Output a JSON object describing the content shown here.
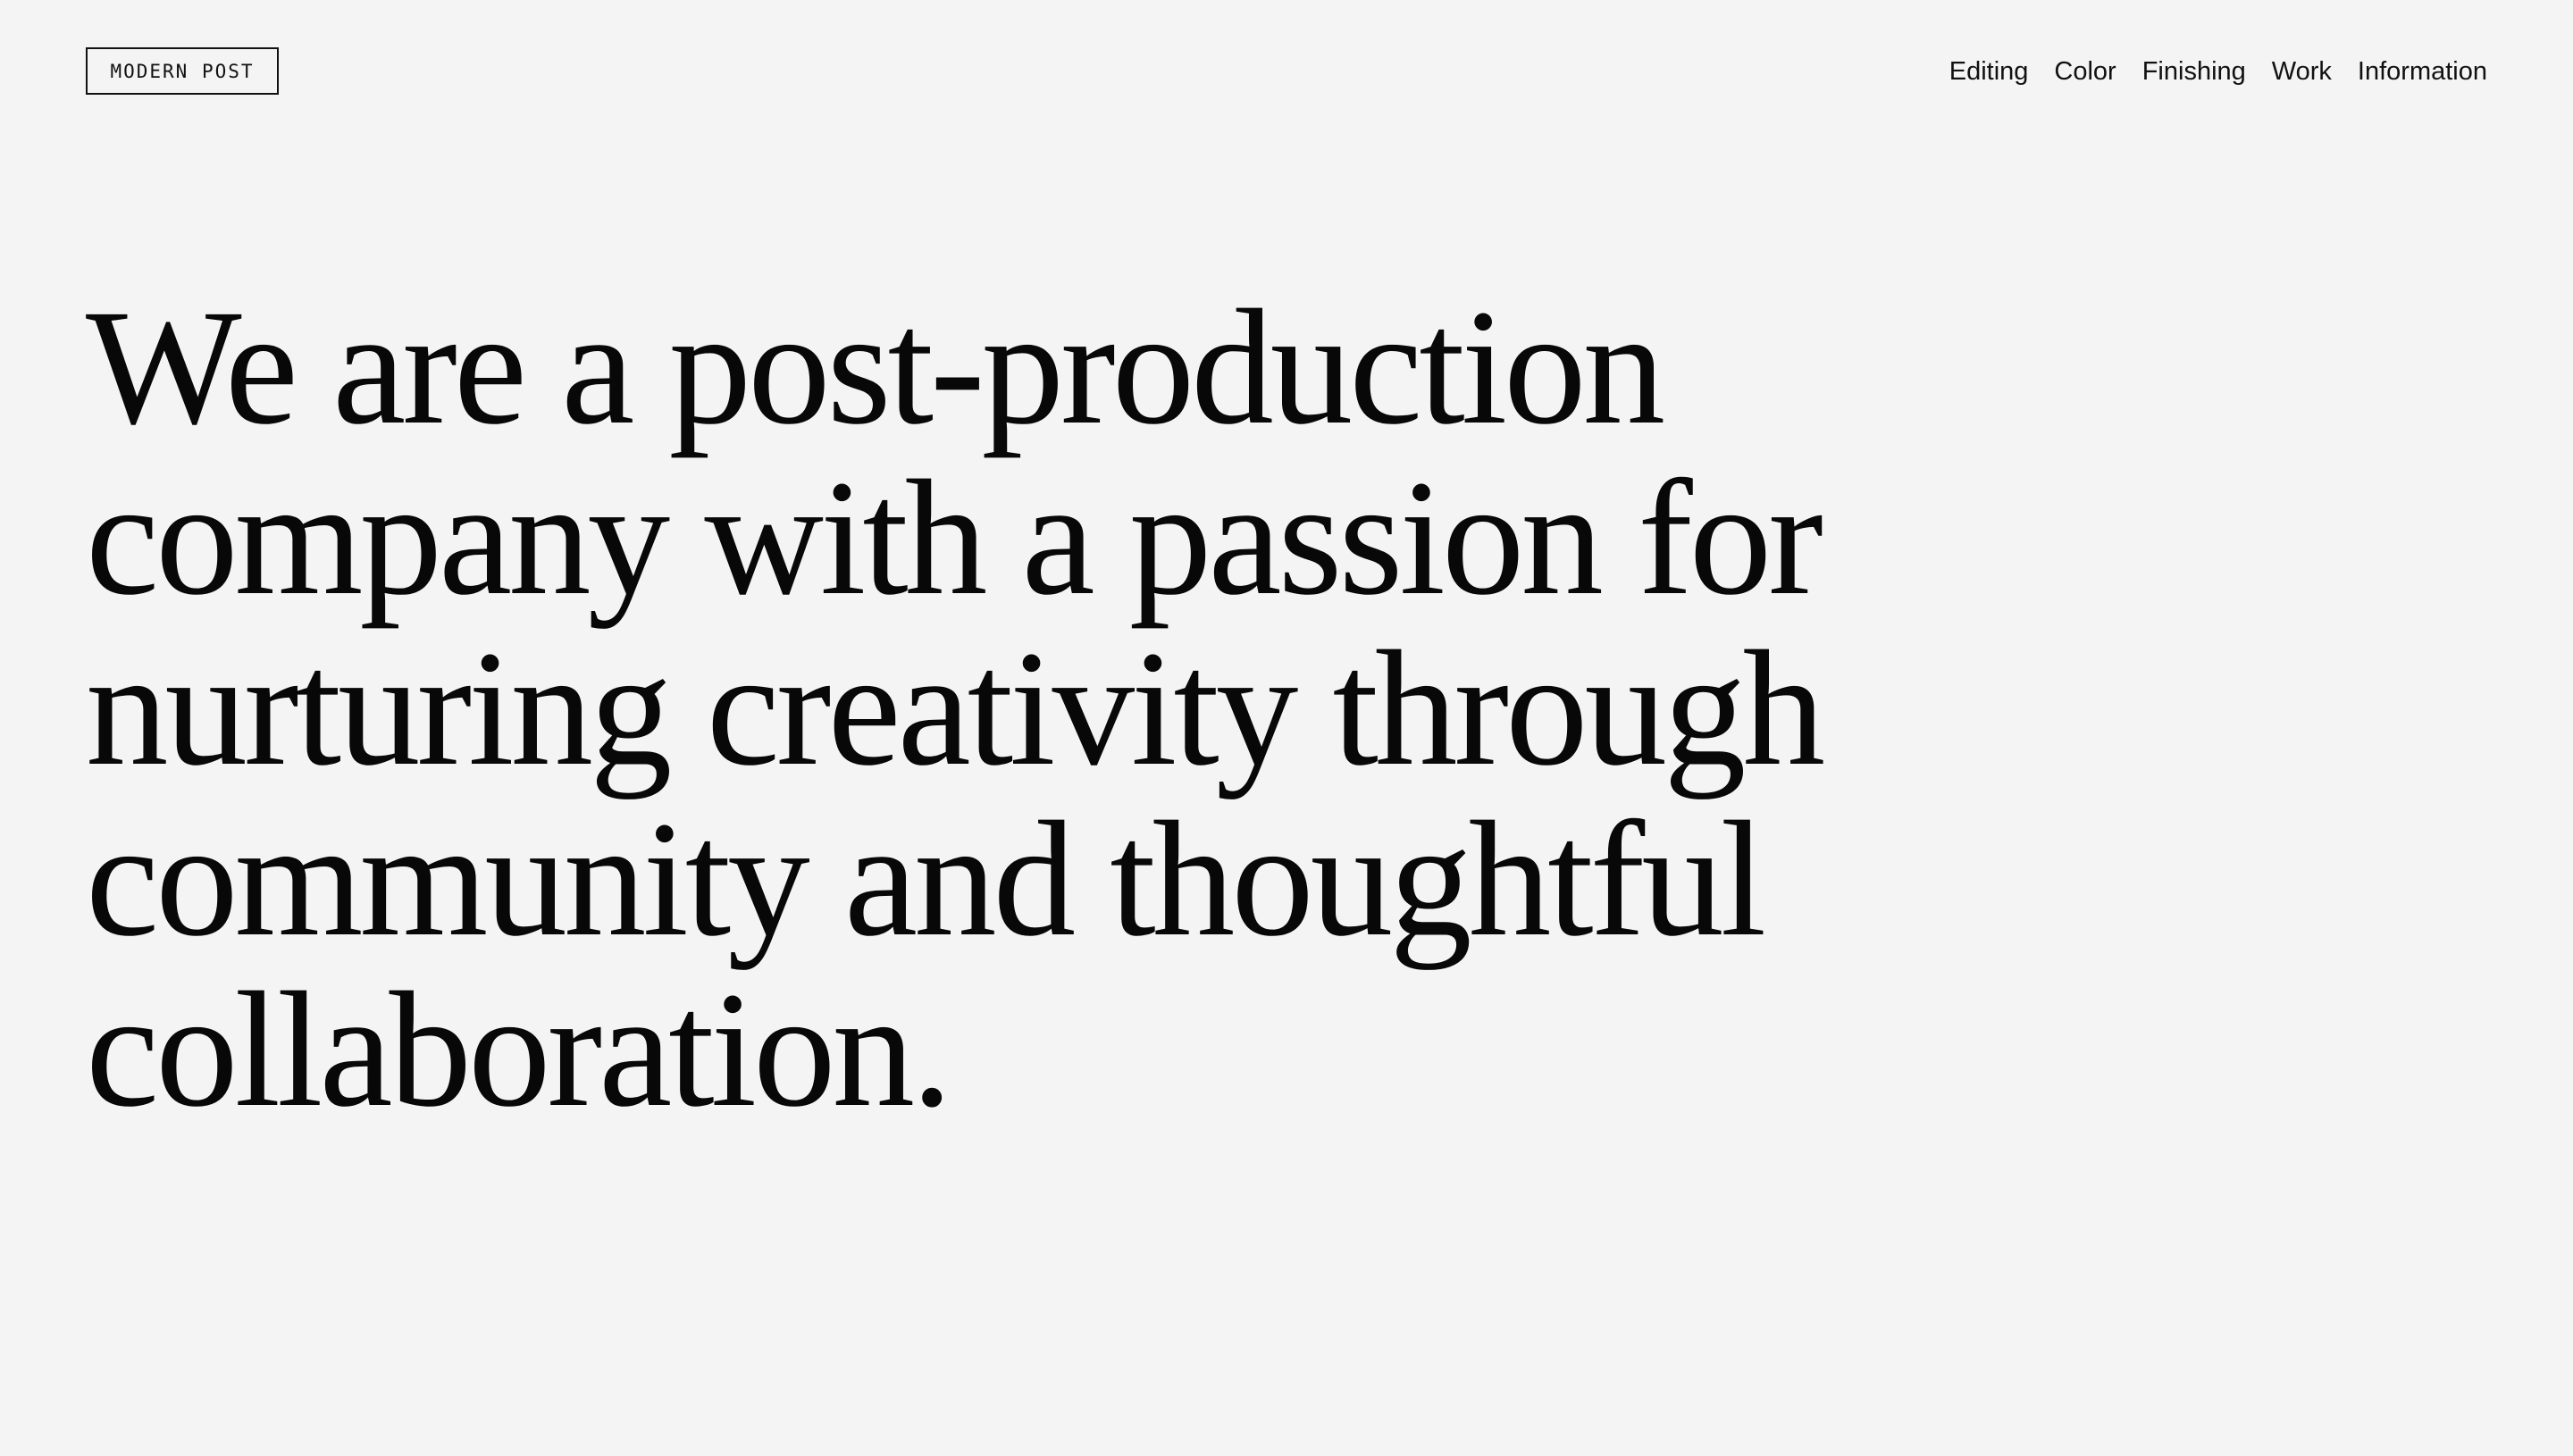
{
  "header": {
    "logo_text": "MODERN POST",
    "nav": [
      {
        "label": "Editing"
      },
      {
        "label": "Color"
      },
      {
        "label": "Finishing"
      },
      {
        "label": "Work"
      },
      {
        "label": "Information"
      }
    ]
  },
  "hero": {
    "text": "We are a post-production company with a passion for nurturing creativity through community and thoughtful collaboration."
  },
  "colors": {
    "background": "#f4f4f4",
    "text": "#0b0b0b",
    "border": "#111111"
  }
}
